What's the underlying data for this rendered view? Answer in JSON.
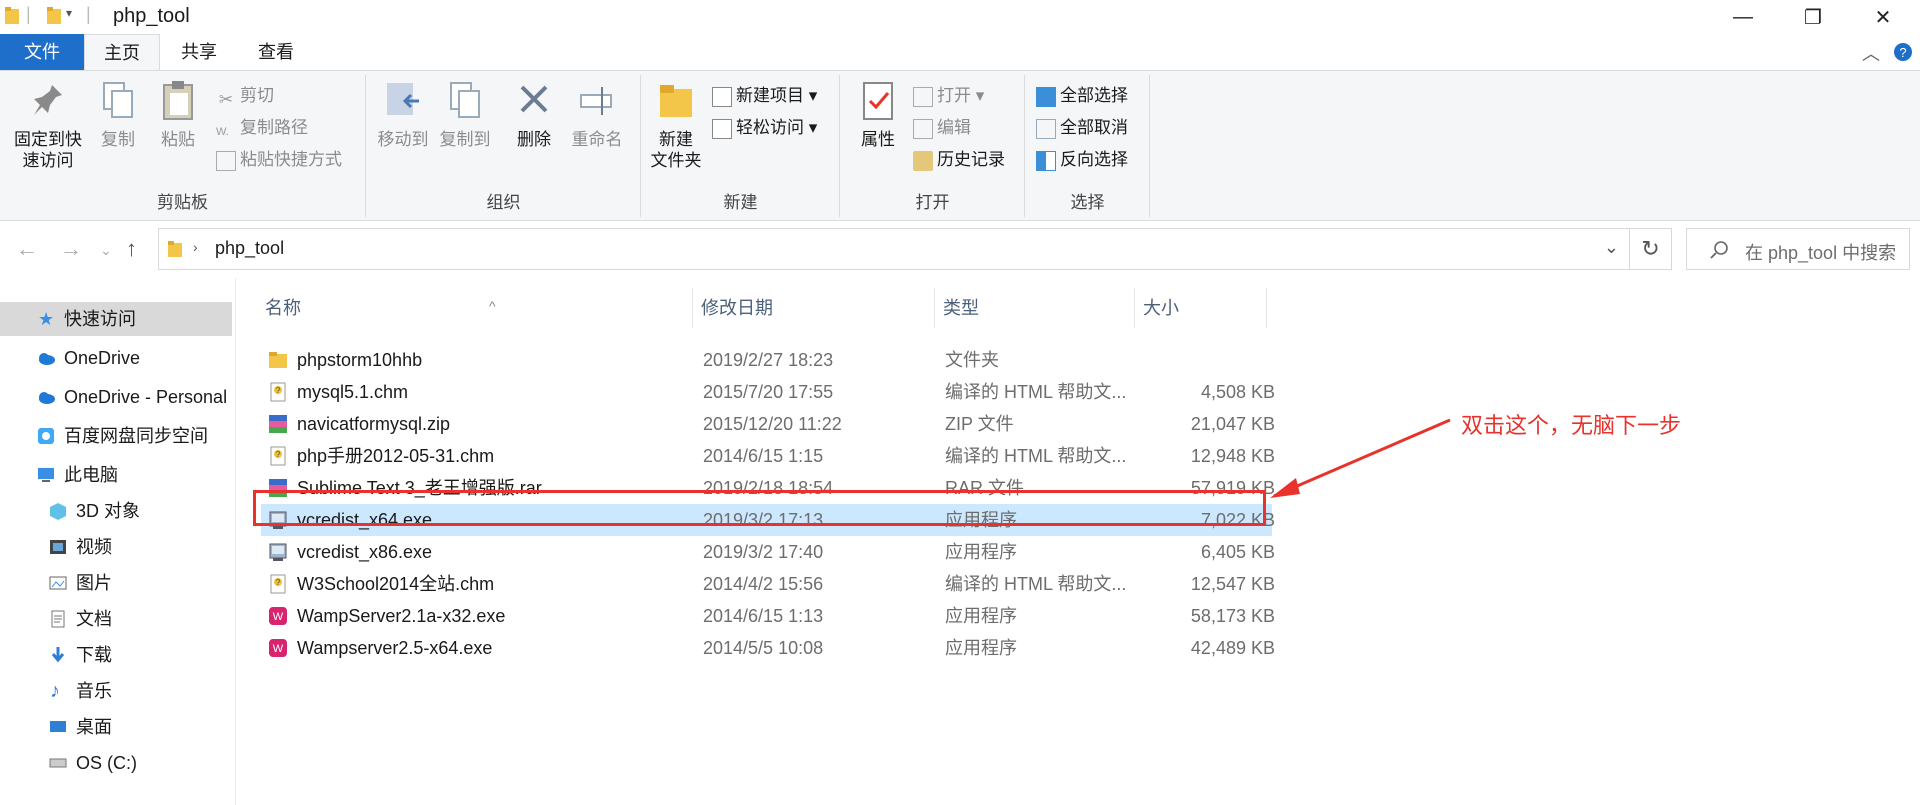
{
  "window": {
    "title": "php_tool",
    "minimize": "—",
    "maximize": "❐",
    "close": "✕"
  },
  "tabs": [
    {
      "label": "文件"
    },
    {
      "label": "主页"
    },
    {
      "label": "共享"
    },
    {
      "label": "查看"
    }
  ],
  "ribbon": {
    "clipboard": {
      "pin": "固定到快速访问",
      "pin_l1": "固定到快",
      "pin_l2": "速访问",
      "copy": "复制",
      "paste": "粘贴",
      "cut": "剪切",
      "copy_path": "复制路径",
      "paste_shortcut": "粘贴快捷方式",
      "label": "剪贴板"
    },
    "organize": {
      "move_to": "移动到",
      "copy_to": "复制到",
      "delete": "删除",
      "rename": "重命名",
      "label": "组织"
    },
    "new": {
      "new_folder_l1": "新建",
      "new_folder_l2": "文件夹",
      "new_item": "新建项目",
      "easy_access": "轻松访问",
      "label": "新建"
    },
    "open": {
      "properties": "属性",
      "open": "打开",
      "edit": "编辑",
      "history": "历史记录",
      "label": "打开"
    },
    "select": {
      "select_all": "全部选择",
      "select_none": "全部取消",
      "invert": "反向选择",
      "label": "选择"
    }
  },
  "address": {
    "path": "php_tool",
    "search_placeholder": "在 php_tool 中搜索"
  },
  "sidebar": {
    "items": [
      {
        "label": "快速访问",
        "icon": "star-icon"
      },
      {
        "label": "OneDrive",
        "icon": "cloud-icon"
      },
      {
        "label": "OneDrive - Personal",
        "icon": "cloud-icon"
      },
      {
        "label": "百度网盘同步空间",
        "icon": "baidu-icon"
      },
      {
        "label": "此电脑",
        "icon": "pc-icon"
      },
      {
        "label": "3D 对象",
        "icon": "cube-icon"
      },
      {
        "label": "视频",
        "icon": "video-icon"
      },
      {
        "label": "图片",
        "icon": "picture-icon"
      },
      {
        "label": "文档",
        "icon": "document-icon"
      },
      {
        "label": "下载",
        "icon": "download-icon"
      },
      {
        "label": "音乐",
        "icon": "music-icon"
      },
      {
        "label": "桌面",
        "icon": "desktop-icon"
      },
      {
        "label": "OS (C:)",
        "icon": "drive-icon"
      }
    ]
  },
  "columns": {
    "name": "名称",
    "date": "修改日期",
    "type": "类型",
    "size": "大小"
  },
  "files": [
    {
      "name": "phpstorm10hhb",
      "date": "2019/2/27 18:23",
      "type": "文件夹",
      "size": "",
      "icon": "folder-icon"
    },
    {
      "name": "mysql5.1.chm",
      "date": "2015/7/20 17:55",
      "type": "编译的 HTML 帮助文...",
      "size": "4,508 KB",
      "icon": "chm-icon"
    },
    {
      "name": "navicatformysql.zip",
      "date": "2015/12/20 11:22",
      "type": "ZIP 文件",
      "size": "21,047 KB",
      "icon": "archive-icon"
    },
    {
      "name": "php手册2012-05-31.chm",
      "date": "2014/6/15 1:15",
      "type": "编译的 HTML 帮助文...",
      "size": "12,948 KB",
      "icon": "chm-icon"
    },
    {
      "name": "Sublime Text 3_老王增强版.rar",
      "date": "2019/2/18 18:54",
      "type": "RAR 文件",
      "size": "57,919 KB",
      "icon": "archive-icon"
    },
    {
      "name": "vcredist_x64.exe",
      "date": "2019/3/2 17:13",
      "type": "应用程序",
      "size": "7,022 KB",
      "icon": "installer-icon",
      "selected": true
    },
    {
      "name": "vcredist_x86.exe",
      "date": "2019/3/2 17:40",
      "type": "应用程序",
      "size": "6,405 KB",
      "icon": "installer-icon"
    },
    {
      "name": "W3School2014全站.chm",
      "date": "2014/4/2 15:56",
      "type": "编译的 HTML 帮助文...",
      "size": "12,547 KB",
      "icon": "chm-icon"
    },
    {
      "name": "WampServer2.1a-x32.exe",
      "date": "2014/6/15 1:13",
      "type": "应用程序",
      "size": "58,173 KB",
      "icon": "wamp-icon"
    },
    {
      "name": "Wampserver2.5-x64.exe",
      "date": "2014/5/5 10:08",
      "type": "应用程序",
      "size": "42,489 KB",
      "icon": "wamp-icon"
    }
  ],
  "annotation": {
    "text": "双击这个，无脑下一步",
    "color": "#e8322b"
  }
}
